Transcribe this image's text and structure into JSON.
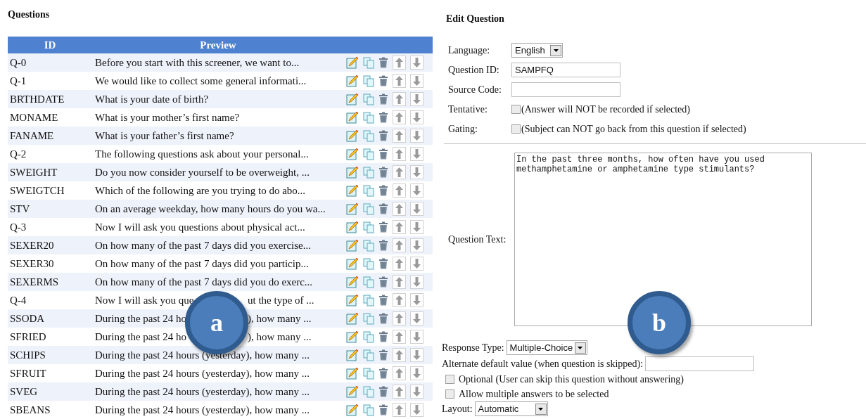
{
  "questions": {
    "title": "Questions",
    "columns": [
      "ID",
      "Preview"
    ],
    "rows": [
      {
        "id": "Q-0",
        "preview": "Before you start with this screener, we want to..."
      },
      {
        "id": "Q-1",
        "preview": "We would like to collect some general informati..."
      },
      {
        "id": "BRTHDATE",
        "preview": "What is your date of birth?"
      },
      {
        "id": "MONAME",
        "preview": "What is your mother’s first name?"
      },
      {
        "id": "FANAME",
        "preview": "What is your father’s first name?"
      },
      {
        "id": "Q-2",
        "preview": "The following questions ask about your personal..."
      },
      {
        "id": "SWEIGHT",
        "preview": "Do you now consider yourself to be overweight, ..."
      },
      {
        "id": "SWEIGTCH",
        "preview": "Which of the following are you trying to do abo..."
      },
      {
        "id": "STV",
        "preview": "On an average weekday, how many hours do you wa..."
      },
      {
        "id": "Q-3",
        "preview": "Now I will ask you questions about physical act..."
      },
      {
        "id": "SEXER20",
        "preview": "On how many of the past 7 days did you exercise..."
      },
      {
        "id": "SEXER30",
        "preview": "On how many of the past 7 days did you particip..."
      },
      {
        "id": "SEXERMS",
        "preview": "On how many of the past 7 days did you do exerc..."
      },
      {
        "id": "Q-4",
        "preview": "Now I will ask you que",
        "preview_after": "ut the type of ..."
      },
      {
        "id": "SSODA",
        "preview": "During the past 24 ho",
        "preview_after": "), how many ..."
      },
      {
        "id": "SFRIED",
        "preview": "During the past 24 ho",
        "preview_after": "), how many ..."
      },
      {
        "id": "SCHIPS",
        "preview": "During the past 24 hours (yesterday), how many ..."
      },
      {
        "id": "SFRUIT",
        "preview": "During the past 24 hours (yesterday), how many ..."
      },
      {
        "id": "SVEG",
        "preview": "During the past 24 hours (yesterday), how many ..."
      },
      {
        "id": "SBEANS",
        "preview": "During the past 24 hours (yesterday), how many ..."
      }
    ]
  },
  "edit": {
    "title": "Edit Question",
    "language": {
      "label": "Language:",
      "value": "English"
    },
    "question_id": {
      "label": "Question ID:",
      "value": "SAMPFQ"
    },
    "source_code": {
      "label": "Source Code:"
    },
    "tentative": {
      "label": "Tentative:",
      "text": "(Answer will NOT be recorded if selected)",
      "checked": false
    },
    "gating": {
      "label": "Gating:",
      "text": "(Subject can NOT go back from this question if selected)",
      "checked": false
    },
    "question_text": {
      "label": "Question Text:",
      "value": "In the past three months, how often have you used methamphetamine or amphetamine type stimulants?"
    },
    "response_type": {
      "label": "Response Type:",
      "value": "Multiple-Choice"
    },
    "alternate_default": {
      "label": "Alternate default value (when question is skipped):"
    },
    "optional": {
      "text": "Optional (User can skip this question without answering)",
      "checked": false
    },
    "multiple": {
      "text": "Allow multiple answers to be selected",
      "checked": false
    },
    "layout": {
      "label": "Layout:",
      "value": "Automatic"
    }
  },
  "callouts": [
    "a",
    "b"
  ]
}
